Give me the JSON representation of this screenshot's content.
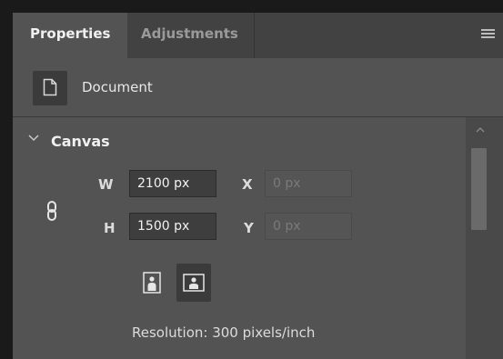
{
  "tabs": [
    {
      "label": "Properties",
      "active": true
    },
    {
      "label": "Adjustments",
      "active": false
    }
  ],
  "header": {
    "menu_icon": "hamburger-menu-icon"
  },
  "document": {
    "icon": "document-icon",
    "label": "Document"
  },
  "canvas": {
    "title": "Canvas",
    "expanded": true,
    "link_icon": "chain-link-icon",
    "width": {
      "label": "W",
      "value": "2100 px"
    },
    "height": {
      "label": "H",
      "value": "1500 px"
    },
    "x": {
      "label": "X",
      "placeholder": "0 px"
    },
    "y": {
      "label": "Y",
      "placeholder": "0 px"
    },
    "orientation": {
      "portrait_icon": "portrait-orientation-icon",
      "landscape_icon": "landscape-orientation-icon",
      "selected": "landscape"
    },
    "resolution": "Resolution: 300 pixels/inch"
  },
  "colors": {
    "panel_bg": "#535353",
    "tabbar_bg": "#424242",
    "field_bg": "#3e3e3e",
    "text": "#e8e8e8"
  }
}
